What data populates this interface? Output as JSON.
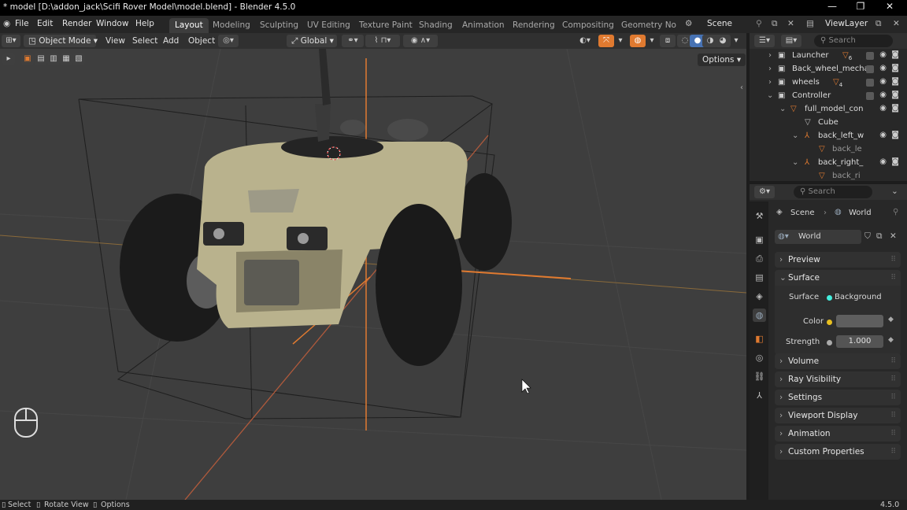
{
  "window": {
    "title": "* model [D:\\addon_jack\\Scifi Rover Model\\model.blend] - Blender 4.5.0",
    "minimize": "—",
    "maximize": "❐",
    "close": "✕"
  },
  "menus": [
    "File",
    "Edit",
    "Render",
    "Window",
    "Help"
  ],
  "workspaces": [
    "Layout",
    "Modeling",
    "Sculpting",
    "UV Editing",
    "Texture Paint",
    "Shading",
    "Animation",
    "Rendering",
    "Compositing",
    "Geometry Node"
  ],
  "scene": {
    "name": "Scene",
    "view_layer": "ViewLayer"
  },
  "viewport_header": {
    "mode": "Object Mode",
    "view": "View",
    "select": "Select",
    "add": "Add",
    "object": "Object",
    "transform": "Global",
    "options": "Options"
  },
  "outliner": {
    "search_placeholder": "Search",
    "rows": [
      {
        "label": "Launcher",
        "badge": "6"
      },
      {
        "label": "Back_wheel_mecha",
        "badge": ""
      },
      {
        "label": "wheels",
        "badge": "4"
      },
      {
        "label": "Controller",
        "badge": ""
      },
      {
        "label": "full_model_con",
        "badge": ""
      },
      {
        "label": "Cube",
        "badge": ""
      },
      {
        "label": "back_left_w",
        "badge": ""
      },
      {
        "label": "back_le",
        "badge": ""
      },
      {
        "label": "back_right_",
        "badge": ""
      },
      {
        "label": "back_ri",
        "badge": ""
      }
    ]
  },
  "properties": {
    "search_placeholder": "Search",
    "breadcrumb": {
      "scene": "Scene",
      "world": "World"
    },
    "world_name": "World",
    "sections": {
      "preview": "Preview",
      "surface": "Surface",
      "volume": "Volume",
      "ray_visibility": "Ray Visibility",
      "settings": "Settings",
      "viewport_display": "Viewport Display",
      "animation": "Animation",
      "custom_properties": "Custom Properties"
    },
    "surface_label": "Surface",
    "surface_value": "Background",
    "color_label": "Color",
    "strength_label": "Strength",
    "strength_value": "1.000"
  },
  "statusbar": {
    "select": "Select",
    "rotate": "Rotate View",
    "options": "Options",
    "version": "4.5.0"
  },
  "colors": {
    "accent": "#e07a30",
    "active_blue": "#4772b3",
    "viewport_bg": "#3e3e3e",
    "panel_bg": "#282828"
  }
}
